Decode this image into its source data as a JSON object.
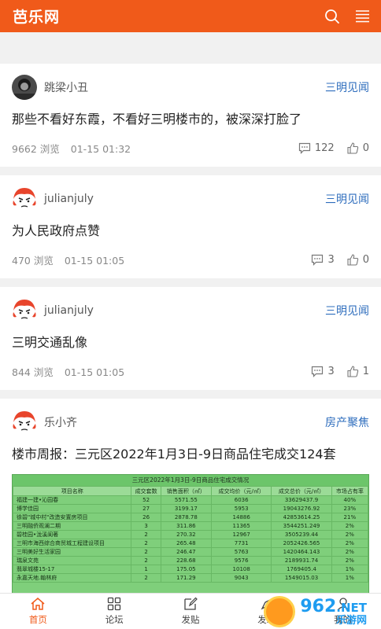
{
  "header": {
    "logo": "芭乐网",
    "bg": "#f05a1a"
  },
  "posts": [
    {
      "user": "跳梁小丑",
      "forum": "三明见闻",
      "title": "那些不看好东霞，不看好三明楼市的，被深深打脸了",
      "views": "9662 浏览",
      "time": "01-15 01:32",
      "comments": "122",
      "likes": "0",
      "avatar": "dark-avatar"
    },
    {
      "user": "julianjuly",
      "forum": "三明见闻",
      "title": "为人民政府点赞",
      "views": "470 浏览",
      "time": "01-15 01:05",
      "comments": "3",
      "likes": "0",
      "avatar": "face-avatar"
    },
    {
      "user": "julianjuly",
      "forum": "三明见闻",
      "title": "三明交通乱像",
      "views": "844 浏览",
      "time": "01-15 01:05",
      "comments": "3",
      "likes": "1",
      "avatar": "face-avatar"
    },
    {
      "user": "乐小齐",
      "forum": "房产聚焦",
      "title": "楼市周报：三元区2022年1月3日-9日商品住宅成交124套",
      "avatar": "face-avatar"
    }
  ],
  "embedded_table": {
    "title": "三元区2022年1月3日-9日商品住宅成交情况",
    "headers": [
      "项目名称",
      "成交套数",
      "销售面积（㎡）",
      "成交均价（元/㎡）",
      "成交总价（元/㎡）",
      "市场占有率"
    ],
    "rows": [
      [
        "福建一建•沁园春",
        "52",
        "5571.55",
        "6036",
        "33629437.9",
        "40%"
      ],
      [
        "博学佳园",
        "27",
        "3199.17",
        "5953",
        "19043276.92",
        "23%"
      ],
      [
        "徐碧\"城中村\"改造安置房项目",
        "26",
        "2878.78",
        "14886",
        "42853614.25",
        "21%"
      ],
      [
        "三明融侨观澜二期",
        "3",
        "311.86",
        "11365",
        "3544251.249",
        "2%"
      ],
      [
        "碧桂园•泷溪阆著",
        "2",
        "270.32",
        "12967",
        "3505239.44",
        "2%"
      ],
      [
        "三明市海西综合商贸城工程建设项目",
        "2",
        "265.48",
        "7731",
        "2052426.565",
        "2%"
      ],
      [
        "三明美好生活家园",
        "2",
        "246.47",
        "5763",
        "1420464.143",
        "2%"
      ],
      [
        "瑞泉文苑",
        "2",
        "228.68",
        "9576",
        "2189931.74",
        "2%"
      ],
      [
        "翡翠城楼15-17",
        "1",
        "175.05",
        "10108",
        "1769405.4",
        "1%"
      ],
      [
        "永嘉天地.翰林府",
        "2",
        "171.29",
        "9043",
        "1549015.03",
        "1%"
      ]
    ]
  },
  "tabs": [
    {
      "label": "首页",
      "active": true,
      "icon": "home-icon"
    },
    {
      "label": "论坛",
      "active": false,
      "icon": "grid-icon"
    },
    {
      "label": "发贴",
      "active": false,
      "icon": "edit-icon"
    },
    {
      "label": "发现",
      "active": false,
      "icon": "compass-icon"
    },
    {
      "label": "我的",
      "active": false,
      "icon": "user-icon"
    }
  ],
  "watermark": {
    "big": "962",
    "net": ".NET",
    "small": "乐游网"
  }
}
